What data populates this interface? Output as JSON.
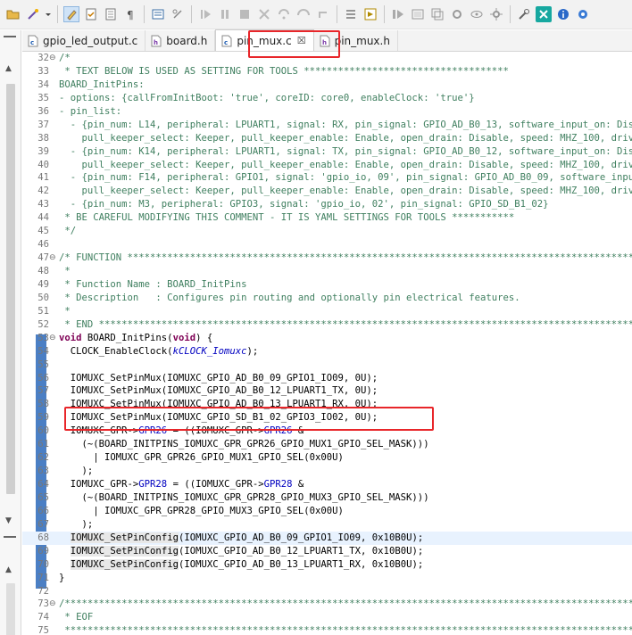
{
  "toolbar": {
    "icons": [
      "open-folder-icon",
      "wand-icon",
      "dropdown-arrow-icon",
      "highlight-pen-icon",
      "check-doc-icon",
      "doc-icon",
      "paragraph-icon",
      "terminal-icon",
      "link-icon",
      "resume-icon",
      "pause-icon",
      "stop-icon",
      "disconnect-icon",
      "step-into-icon",
      "step-over-icon",
      "step-return-icon",
      "debug-list-icon",
      "debug-run-icon",
      "instruction-step-icon",
      "frame-icon",
      "layers-icon",
      "gear-link-icon",
      "eye-icon",
      "settings-icon",
      "tools-icon",
      "x-icon",
      "info-icon",
      "gear-icon"
    ]
  },
  "tabs": [
    {
      "label": "gpio_led_output.c",
      "type": "c"
    },
    {
      "label": "board.h",
      "type": "h"
    },
    {
      "label": "pin_mux.c",
      "type": "c",
      "active": true,
      "close": "☒"
    },
    {
      "label": "pin_mux.h",
      "type": "h"
    }
  ],
  "colors": {
    "highlight_box": "#e8262a",
    "comment": "#3f7f5f",
    "keyword": "#7f0055",
    "line_bar": "#4b7fc4"
  },
  "code_lines": [
    {
      "n": "32",
      "fold": "⊖",
      "text": "/*"
    },
    {
      "n": "33",
      "text": " * TEXT BELOW IS USED AS SETTING FOR TOOLS ************************************"
    },
    {
      "n": "34",
      "text": "BOARD_InitPins:"
    },
    {
      "n": "35",
      "text": "- options: {callFromInitBoot: 'true', coreID: core0, enableClock: 'true'}"
    },
    {
      "n": "36",
      "text": "- pin_list:"
    },
    {
      "n": "37",
      "text": "  - {pin_num: L14, peripheral: LPUART1, signal: RX, pin_signal: GPIO_AD_B0_13, software_input_on: Disable, hys"
    },
    {
      "n": "38",
      "text": "    pull_keeper_select: Keeper, pull_keeper_enable: Enable, open_drain: Disable, speed: MHZ_100, drive_strength"
    },
    {
      "n": "39",
      "text": "  - {pin_num: K14, peripheral: LPUART1, signal: TX, pin_signal: GPIO_AD_B0_12, software_input_on: Disable, hys"
    },
    {
      "n": "40",
      "text": "    pull_keeper_select: Keeper, pull_keeper_enable: Enable, open_drain: Disable, speed: MHZ_100, drive_strength"
    },
    {
      "n": "41",
      "text": "  - {pin_num: F14, peripheral: GPIO1, signal: 'gpio_io, 09', pin_signal: GPIO_AD_B0_09, software_input_on: Dis"
    },
    {
      "n": "42",
      "text": "    pull_keeper_select: Keeper, pull_keeper_enable: Enable, open_drain: Disable, speed: MHZ_100, drive_strength"
    },
    {
      "n": "43",
      "text": "  - {pin_num: M3, peripheral: GPIO3, signal: 'gpio_io, 02', pin_signal: GPIO_SD_B1_02}"
    },
    {
      "n": "44",
      "text": " * BE CAREFUL MODIFYING THIS COMMENT - IT IS YAML SETTINGS FOR TOOLS ***********"
    },
    {
      "n": "45",
      "text": " */"
    },
    {
      "n": "46",
      "text": ""
    },
    {
      "n": "47",
      "fold": "⊖",
      "text": "/* FUNCTION ************************************************************************************************"
    },
    {
      "n": "48",
      "text": " *"
    },
    {
      "n": "49",
      "text": " * Function Name : BOARD_InitPins"
    },
    {
      "n": "50",
      "text": " * Description   : Configures pin routing and optionally pin electrical features."
    },
    {
      "n": "51",
      "text": " *"
    },
    {
      "n": "52",
      "text": " * END *****************************************************************************************************"
    },
    {
      "n": "53",
      "fold": "⊖",
      "text": "void BOARD_InitPins(void) {"
    },
    {
      "n": "54",
      "text": "  CLOCK_EnableClock(kCLOCK_Iomuxc);"
    },
    {
      "n": "55",
      "text": ""
    },
    {
      "n": "56",
      "text": "  IOMUXC_SetPinMux(IOMUXC_GPIO_AD_B0_09_GPIO1_IO09, 0U);"
    },
    {
      "n": "57",
      "text": "  IOMUXC_SetPinMux(IOMUXC_GPIO_AD_B0_12_LPUART1_TX, 0U);"
    },
    {
      "n": "58",
      "text": "  IOMUXC_SetPinMux(IOMUXC_GPIO_AD_B0_13_LPUART1_RX, 0U);"
    },
    {
      "n": "59",
      "text": "  IOMUXC_SetPinMux(IOMUXC_GPIO_SD_B1_02_GPIO3_IO02, 0U);"
    },
    {
      "n": "60",
      "text": "  IOMUXC_GPR->GPR26 = ((IOMUXC_GPR->GPR26 &"
    },
    {
      "n": "61",
      "text": "    (~(BOARD_INITPINS_IOMUXC_GPR_GPR26_GPIO_MUX1_GPIO_SEL_MASK)))"
    },
    {
      "n": "62",
      "text": "      | IOMUXC_GPR_GPR26_GPIO_MUX1_GPIO_SEL(0x00U)"
    },
    {
      "n": "63",
      "text": "    );"
    },
    {
      "n": "64",
      "text": "  IOMUXC_GPR->GPR28 = ((IOMUXC_GPR->GPR28 &"
    },
    {
      "n": "65",
      "text": "    (~(BOARD_INITPINS_IOMUXC_GPR_GPR28_GPIO_MUX3_GPIO_SEL_MASK)))"
    },
    {
      "n": "66",
      "text": "      | IOMUXC_GPR_GPR28_GPIO_MUX3_GPIO_SEL(0x00U)"
    },
    {
      "n": "67",
      "text": "    );"
    },
    {
      "n": "68",
      "text": "  IOMUXC_SetPinConfig(IOMUXC_GPIO_AD_B0_09_GPIO1_IO09, 0x10B0U);"
    },
    {
      "n": "69",
      "text": "  IOMUXC_SetPinConfig(IOMUXC_GPIO_AD_B0_12_LPUART1_TX, 0x10B0U);"
    },
    {
      "n": "70",
      "text": "  IOMUXC_SetPinConfig(IOMUXC_GPIO_AD_B0_13_LPUART1_RX, 0x10B0U);"
    },
    {
      "n": "71",
      "text": "}"
    },
    {
      "n": "72",
      "text": ""
    },
    {
      "n": "73",
      "fold": "⊖",
      "text": "/*************************************************************************************************************"
    },
    {
      "n": "74",
      "text": " * EOF"
    },
    {
      "n": "75",
      "text": " ************************************************************************************************************"
    }
  ]
}
